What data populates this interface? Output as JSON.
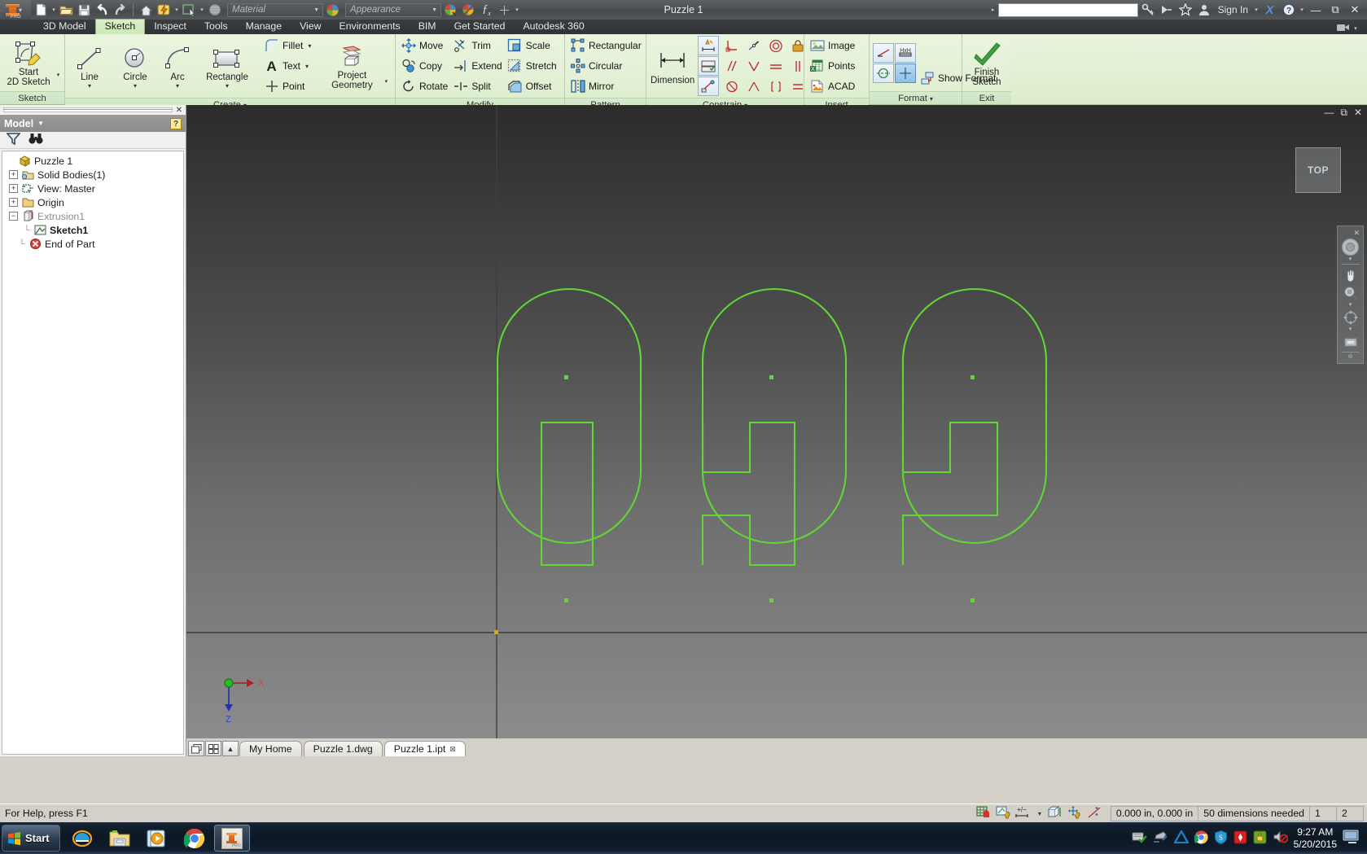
{
  "window": {
    "title": "Puzzle 1",
    "app_name": "Autodesk Inventor Professional",
    "sign_in_label": "Sign In",
    "search_placeholder": "",
    "minimize": "—",
    "maximize": "▭",
    "close": "✕",
    "help": "?",
    "exchange": "X"
  },
  "quick_access": {
    "material_placeholder": "Material",
    "appearance_placeholder": "Appearance",
    "items": [
      {
        "name": "new-document",
        "label": "New"
      },
      {
        "name": "open-document",
        "label": "Open"
      },
      {
        "name": "save-document",
        "label": "Save"
      },
      {
        "name": "undo",
        "label": "Undo"
      },
      {
        "name": "redo",
        "label": "Redo"
      },
      {
        "name": "home-view",
        "label": "Home View"
      },
      {
        "name": "update",
        "label": "Update"
      },
      {
        "name": "select",
        "label": "Select"
      },
      {
        "name": "appearance-sphere",
        "label": "Appearance"
      },
      {
        "name": "adjust",
        "label": "Adjust"
      },
      {
        "name": "clear-appearance",
        "label": "Clear Appearance"
      },
      {
        "name": "parameters",
        "label": "fx"
      },
      {
        "name": "customize",
        "label": "+"
      }
    ]
  },
  "ribbon": {
    "tabs": [
      {
        "label": "3D Model",
        "active": false
      },
      {
        "label": "Sketch",
        "active": true
      },
      {
        "label": "Inspect",
        "active": false
      },
      {
        "label": "Tools",
        "active": false
      },
      {
        "label": "Manage",
        "active": false
      },
      {
        "label": "View",
        "active": false
      },
      {
        "label": "Environments",
        "active": false
      },
      {
        "label": "BIM",
        "active": false
      },
      {
        "label": "Get Started",
        "active": false
      },
      {
        "label": "Autodesk 360",
        "active": false
      }
    ],
    "panels": {
      "sketch": {
        "label": "Sketch",
        "buttons": [
          {
            "label_line1": "Start",
            "label_line2": "2D Sketch",
            "name": "start-2d-sketch"
          }
        ]
      },
      "create": {
        "label": "Create",
        "has_dropdown": true,
        "big_buttons": [
          {
            "label": "Line",
            "name": "line-tool"
          },
          {
            "label": "Circle",
            "name": "circle-tool"
          },
          {
            "label": "Arc",
            "name": "arc-tool"
          },
          {
            "label": "Rectangle",
            "name": "rectangle-tool"
          }
        ],
        "small_buttons": [
          {
            "label": "Fillet",
            "name": "fillet-tool",
            "dropdown": true
          },
          {
            "label": "Text",
            "name": "text-tool",
            "dropdown": true
          },
          {
            "label": "Point",
            "name": "point-tool",
            "dropdown": false
          }
        ],
        "project_geometry": {
          "label_line1": "Project",
          "label_line2": "Geometry",
          "name": "project-geometry"
        }
      },
      "modify": {
        "label": "Modify",
        "buttons": [
          {
            "label": "Move",
            "name": "move-tool"
          },
          {
            "label": "Copy",
            "name": "copy-tool"
          },
          {
            "label": "Rotate",
            "name": "rotate-tool"
          },
          {
            "label": "Trim",
            "name": "trim-tool"
          },
          {
            "label": "Extend",
            "name": "extend-tool"
          },
          {
            "label": "Split",
            "name": "split-tool"
          },
          {
            "label": "Scale",
            "name": "scale-tool"
          },
          {
            "label": "Stretch",
            "name": "stretch-tool"
          },
          {
            "label": "Offset",
            "name": "offset-tool"
          }
        ]
      },
      "pattern": {
        "label": "Pattern",
        "buttons": [
          {
            "label": "Rectangular",
            "name": "rectangular-pattern"
          },
          {
            "label": "Circular",
            "name": "circular-pattern"
          },
          {
            "label": "Mirror",
            "name": "mirror-tool"
          }
        ]
      },
      "constrain": {
        "label": "Constrain",
        "has_dropdown": true,
        "dimension_label": "Dimension",
        "icons": [
          "auto-dimension-icon",
          "dimension-display-icon",
          "show-constraints-icon",
          "perpendicular-icon",
          "parallel-icon",
          "tangent-icon",
          "coincident-icon",
          "concentric-icon",
          "collinear-icon",
          "horizontal-icon",
          "vertical-icon",
          "smooth-icon",
          "symmetric-icon",
          "equal-icon",
          "fix-icon"
        ]
      },
      "insert": {
        "label": "Insert",
        "buttons": [
          {
            "label": "Image",
            "name": "insert-image"
          },
          {
            "label": "Points",
            "name": "insert-points"
          },
          {
            "label": "ACAD",
            "name": "insert-acad"
          }
        ]
      },
      "format": {
        "label": "Format",
        "has_dropdown": true,
        "buttons": [
          {
            "label": "Show Format",
            "name": "show-format"
          }
        ],
        "icons": [
          "construction-line-icon",
          "driven-dimension-icon",
          "centerline-icon",
          "center-point-icon"
        ]
      },
      "exit": {
        "label": "Exit",
        "finish_sketch": {
          "label_line1": "Finish",
          "label_line2": "Sketch",
          "name": "finish-sketch"
        }
      }
    }
  },
  "browser": {
    "title": "Model",
    "filter_icon": "filter-icon",
    "find_icon": "binoculars-icon",
    "help_badge": "?",
    "tree": [
      {
        "label": "Puzzle 1",
        "depth": 0,
        "expander": "",
        "icon": "part-cube-icon",
        "bold": false,
        "dimmed": false
      },
      {
        "label": "Solid Bodies(1)",
        "depth": 1,
        "expander": "+",
        "icon": "solid-bodies-icon",
        "bold": false,
        "dimmed": false
      },
      {
        "label": "View: Master",
        "depth": 1,
        "expander": "+",
        "icon": "view-master-icon",
        "bold": false,
        "dimmed": false
      },
      {
        "label": "Origin",
        "depth": 1,
        "expander": "+",
        "icon": "origin-folder-icon",
        "bold": false,
        "dimmed": false
      },
      {
        "label": "Extrusion1",
        "depth": 1,
        "expander": "−",
        "icon": "extrusion-icon",
        "bold": false,
        "dimmed": true
      },
      {
        "label": "Sketch1",
        "depth": 2,
        "expander": "",
        "icon": "sketch-icon",
        "bold": true,
        "dimmed": false
      },
      {
        "label": "End of Part",
        "depth": 1,
        "expander": "",
        "icon": "end-of-part-icon",
        "bold": false,
        "dimmed": false
      }
    ]
  },
  "canvas": {
    "viewcube_label": "TOP",
    "nav_items": [
      {
        "name": "steering-wheel-icon"
      },
      {
        "name": "pan-hand-icon"
      },
      {
        "name": "zoom-magnifier-icon"
      },
      {
        "name": "orbit-icon"
      },
      {
        "name": "look-at-icon"
      }
    ],
    "axis_labels": {
      "x": "X",
      "z": "Z"
    },
    "sketch_color": "#62d636",
    "sketch_point_color": "#62d636"
  },
  "document_tabs": [
    {
      "label": "My Home",
      "active": false,
      "closable": false
    },
    {
      "label": "Puzzle 1.dwg",
      "active": false,
      "closable": false
    },
    {
      "label": "Puzzle 1.ipt",
      "active": true,
      "closable": true
    }
  ],
  "status_bar": {
    "message": "For Help, press F1",
    "coordinates": "0.000 in, 0.000 in",
    "dimensions_needed": "50 dimensions needed",
    "cell_1": "1",
    "cell_2": "2",
    "tools": [
      "snap-grid-icon",
      "dimension-visibility-icon",
      "dimension-tolerance-icon",
      "slice-graphics-icon",
      "degrees-freedom-icon",
      "constraint-display-icon"
    ]
  },
  "taskbar": {
    "start_label": "Start",
    "items": [
      {
        "name": "internet-explorer-icon",
        "active": false
      },
      {
        "name": "file-explorer-icon",
        "active": false
      },
      {
        "name": "media-player-icon",
        "active": false
      },
      {
        "name": "google-chrome-icon",
        "active": false
      },
      {
        "name": "inventor-icon",
        "active": true
      }
    ],
    "tray_icons": [
      "network-check-icon",
      "usb-eject-icon",
      "autodesk-icon",
      "chrome-tray-icon",
      "security-shield-icon",
      "alert-icon",
      "lock-icon",
      "volume-mute-icon"
    ],
    "time": "9:27 AM",
    "date": "5/20/2015"
  },
  "chart_data": null
}
